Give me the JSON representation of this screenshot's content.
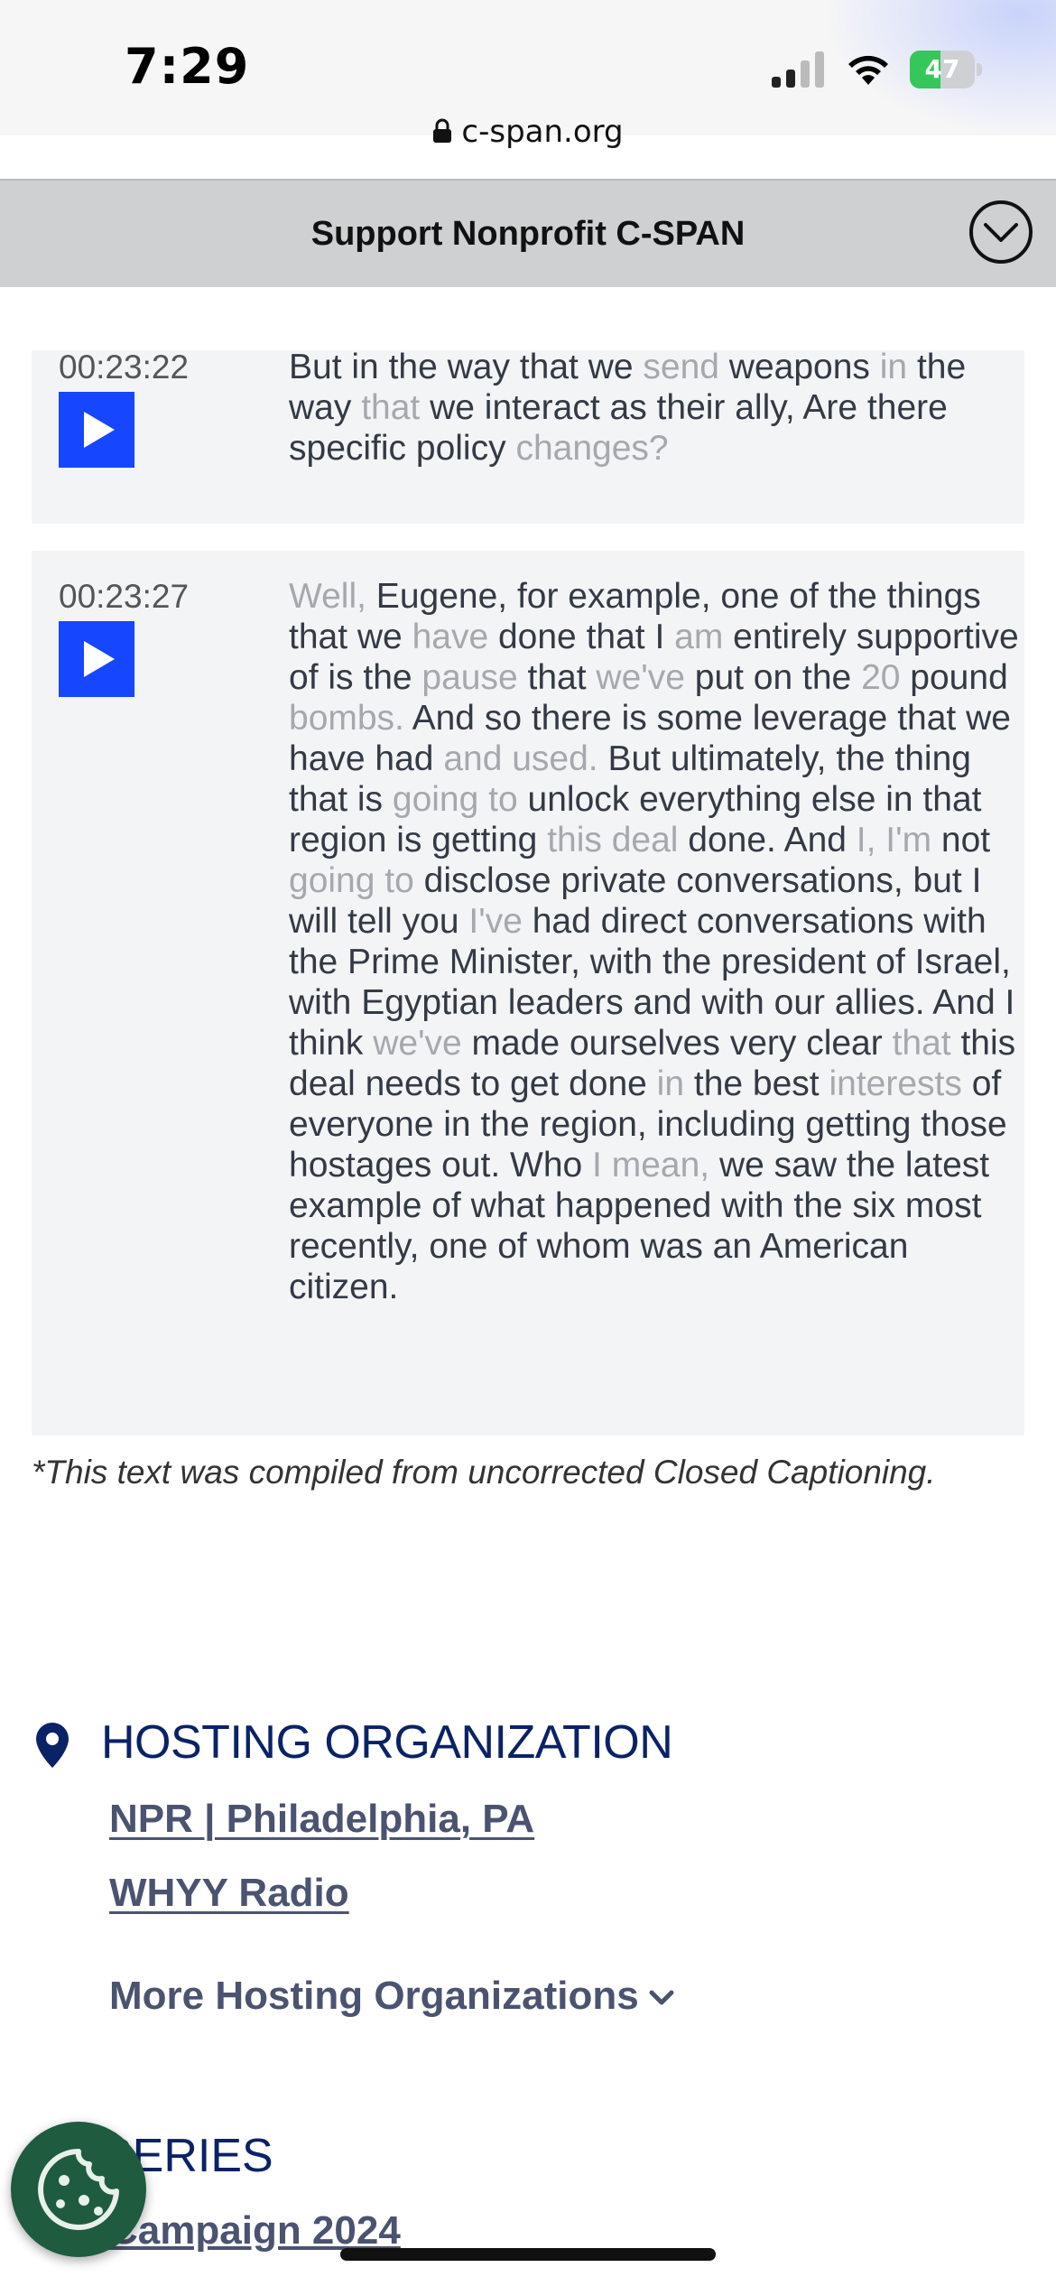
{
  "status_bar": {
    "time": "7:29",
    "battery_level": "47",
    "battery_percent": 47,
    "url": "c-span.org"
  },
  "banner": {
    "text": "Support Nonprofit C-SPAN"
  },
  "transcript": [
    {
      "timestamp": "00:23:22",
      "segments": [
        {
          "t": "But in the way that we ",
          "dim": false
        },
        {
          "t": "send",
          "dim": true
        },
        {
          "t": " weapons ",
          "dim": false
        },
        {
          "t": "in",
          "dim": true
        },
        {
          "t": " the way ",
          "dim": false
        },
        {
          "t": "that",
          "dim": true
        },
        {
          "t": " we interact as their ally, Are there specific policy ",
          "dim": false
        },
        {
          "t": "changes?",
          "dim": true
        }
      ]
    },
    {
      "timestamp": "00:23:27",
      "segments": [
        {
          "t": "Well,",
          "dim": true
        },
        {
          "t": " Eugene, for example, one of the things that we ",
          "dim": false
        },
        {
          "t": "have",
          "dim": true
        },
        {
          "t": " done that I ",
          "dim": false
        },
        {
          "t": "am",
          "dim": true
        },
        {
          "t": " entirely supportive of is the ",
          "dim": false
        },
        {
          "t": "pause",
          "dim": true
        },
        {
          "t": " that ",
          "dim": false
        },
        {
          "t": "we've",
          "dim": true
        },
        {
          "t": " put on the ",
          "dim": false
        },
        {
          "t": "20",
          "dim": true
        },
        {
          "t": " pound ",
          "dim": false
        },
        {
          "t": "bombs.",
          "dim": true
        },
        {
          "t": " And so there is some leverage that we have had ",
          "dim": false
        },
        {
          "t": "and used.",
          "dim": true
        },
        {
          "t": " But ultimately, the thing that is ",
          "dim": false
        },
        {
          "t": "going to",
          "dim": true
        },
        {
          "t": " unlock everything else in that region is getting ",
          "dim": false
        },
        {
          "t": "this deal",
          "dim": true
        },
        {
          "t": " done. And ",
          "dim": false
        },
        {
          "t": "I, I'm",
          "dim": true
        },
        {
          "t": " not ",
          "dim": false
        },
        {
          "t": "going to",
          "dim": true
        },
        {
          "t": " disclose private conversations, but I will tell you ",
          "dim": false
        },
        {
          "t": "I've",
          "dim": true
        },
        {
          "t": " had direct conversations with the Prime Minister, with the president of Israel, with Egyptian leaders and with our allies. And I think ",
          "dim": false
        },
        {
          "t": "we've",
          "dim": true
        },
        {
          "t": " made ourselves very clear ",
          "dim": false
        },
        {
          "t": "that",
          "dim": true
        },
        {
          "t": " this deal needs to get done ",
          "dim": false
        },
        {
          "t": "in",
          "dim": true
        },
        {
          "t": " the best ",
          "dim": false
        },
        {
          "t": "interests",
          "dim": true
        },
        {
          "t": " of everyone in the region, including getting those hostages out. Who ",
          "dim": false
        },
        {
          "t": "I mean,",
          "dim": true
        },
        {
          "t": " we saw the latest example of what happened with the six most recently, one of whom was an American citizen.",
          "dim": false
        }
      ]
    }
  ],
  "caption_note": "*This text was compiled from uncorrected Closed Captioning.",
  "hosting": {
    "heading": "HOSTING ORGANIZATION",
    "orgs": [
      "NPR | Philadelphia, PA",
      "WHYY Radio"
    ],
    "more_label": "More Hosting Organizations"
  },
  "series": {
    "heading": "SERIES",
    "link": "Campaign 2024"
  },
  "colors": {
    "play_button": "#1746ff",
    "heading_navy": "#0a2266",
    "link_slate": "#4a5370",
    "cookie_green": "#1f5b3f",
    "battery_green": "#35c759"
  },
  "icons": [
    "lock-icon",
    "chevron-down-circle-icon",
    "play-icon",
    "map-pin-icon",
    "chevron-down-icon",
    "cookie-icon",
    "signal-icon",
    "wifi-icon",
    "battery-icon"
  ]
}
